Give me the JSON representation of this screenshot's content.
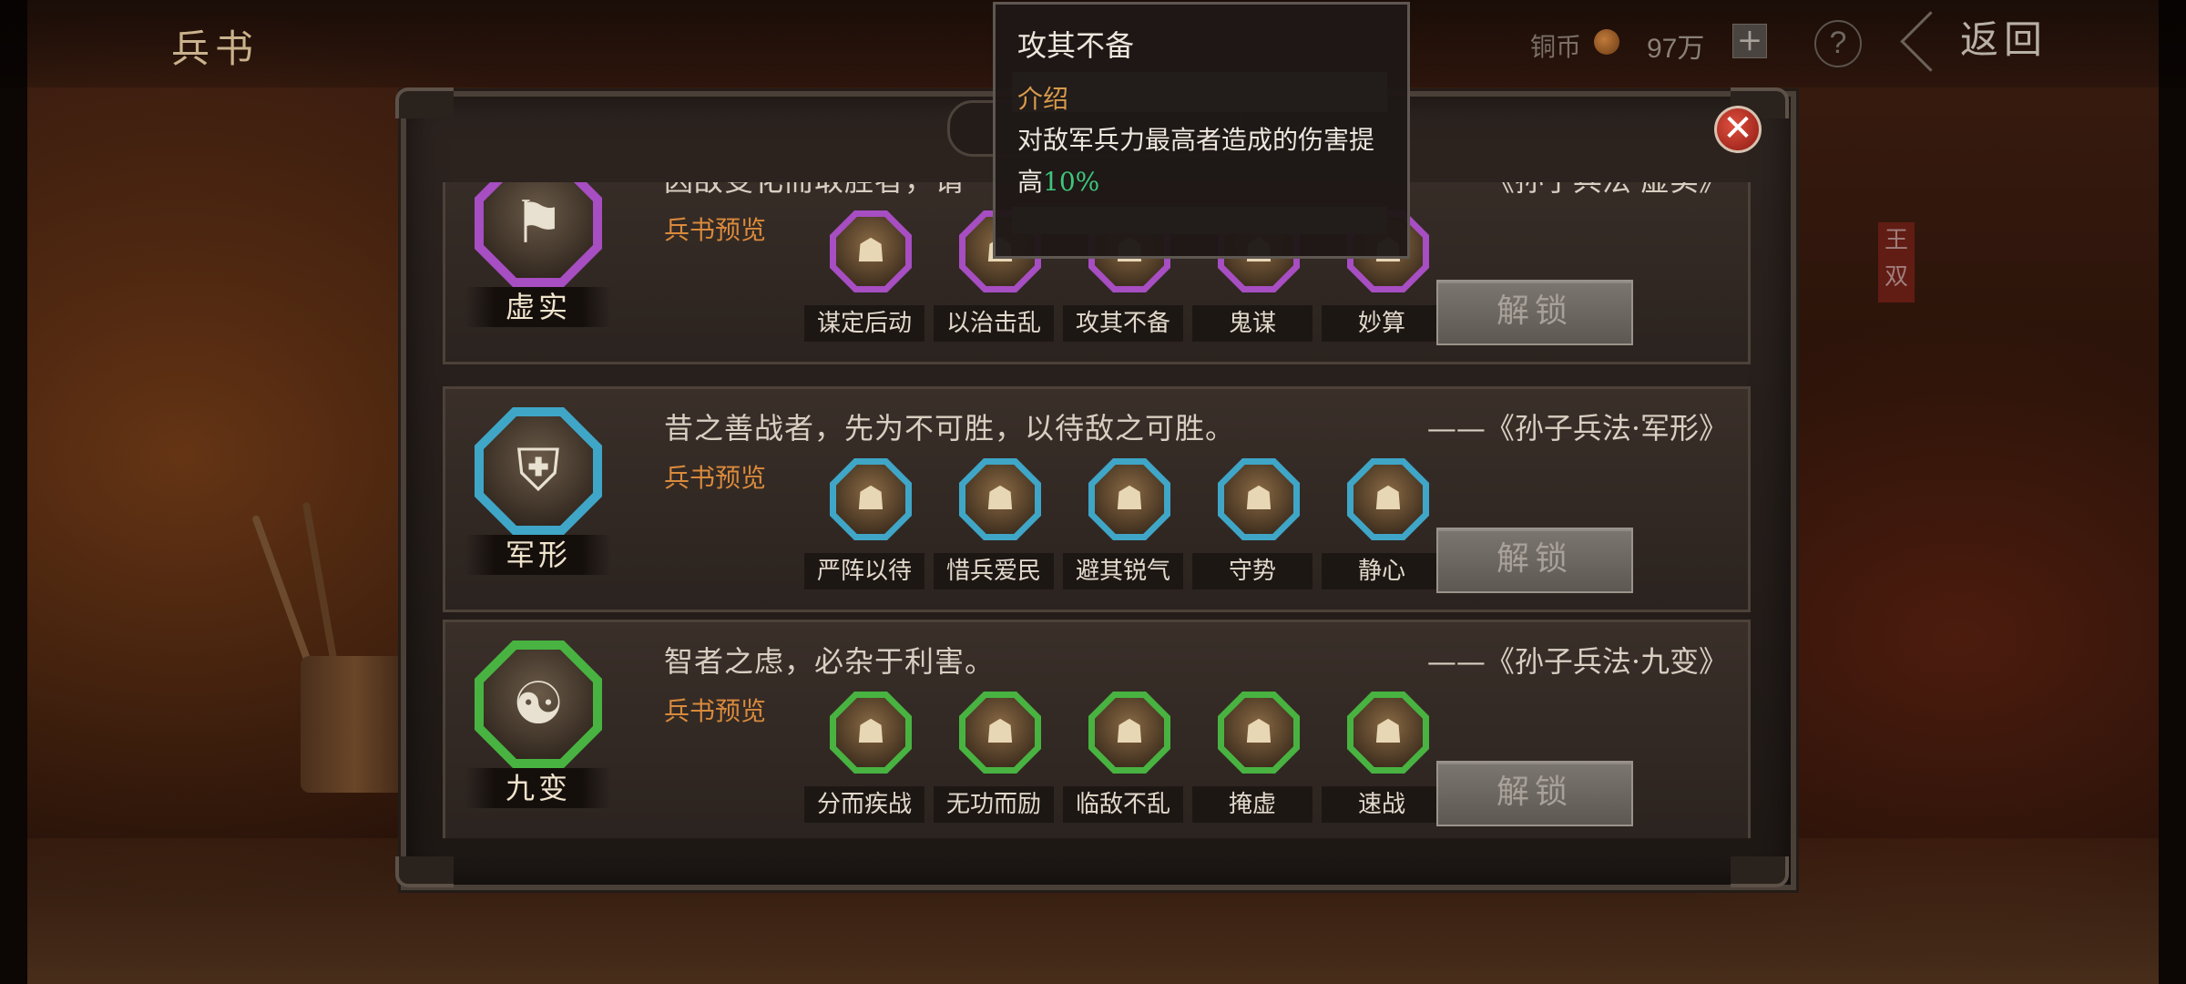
{
  "header": {
    "title": "兵书",
    "coin_label": "铜币",
    "coin_value": "97万",
    "coin_plus": "+",
    "help": "?",
    "back": "返回"
  },
  "background": {
    "side_tag": "王双"
  },
  "panel": {
    "close": "✕"
  },
  "cards": [
    {
      "name": "虚实",
      "quote": "因敌变化而取胜者，谓",
      "source": "《孙子兵法·虚实》",
      "preview": "兵书预览",
      "unlock": "解锁",
      "color": "#a64ec2",
      "glyph": "⚑",
      "skills": [
        {
          "label": "谋定后动",
          "glyph": "☗"
        },
        {
          "label": "以治击乱",
          "glyph": "☗"
        },
        {
          "label": "攻其不备",
          "glyph": "☗"
        },
        {
          "label": "鬼谋",
          "glyph": "☗"
        },
        {
          "label": "妙算",
          "glyph": "☗"
        }
      ]
    },
    {
      "name": "军形",
      "quote": "昔之善战者，先为不可胜，以待敌之可胜。",
      "source": "——《孙子兵法·军形》",
      "preview": "兵书预览",
      "unlock": "解锁",
      "color": "#3fa6c7",
      "glyph": "⛨",
      "skills": [
        {
          "label": "严阵以待",
          "glyph": "☗"
        },
        {
          "label": "惜兵爱民",
          "glyph": "☗"
        },
        {
          "label": "避其锐气",
          "glyph": "☗"
        },
        {
          "label": "守势",
          "glyph": "☗"
        },
        {
          "label": "静心",
          "glyph": "☗"
        }
      ]
    },
    {
      "name": "九变",
      "quote": "智者之虑，必杂于利害。",
      "source": "——《孙子兵法·九变》",
      "preview": "兵书预览",
      "unlock": "解锁",
      "color": "#48b341",
      "glyph": "☯",
      "skills": [
        {
          "label": "分而疾战",
          "glyph": "☗"
        },
        {
          "label": "无功而励",
          "glyph": "☗"
        },
        {
          "label": "临敌不乱",
          "glyph": "☗"
        },
        {
          "label": "掩虚",
          "glyph": "☗"
        },
        {
          "label": "速战",
          "glyph": "☗"
        }
      ]
    }
  ],
  "tooltip": {
    "title": "攻其不备",
    "section_label": "介绍",
    "desc_part1": "对敌军兵力最高者造成的伤害提高",
    "desc_highlight": "10%"
  }
}
